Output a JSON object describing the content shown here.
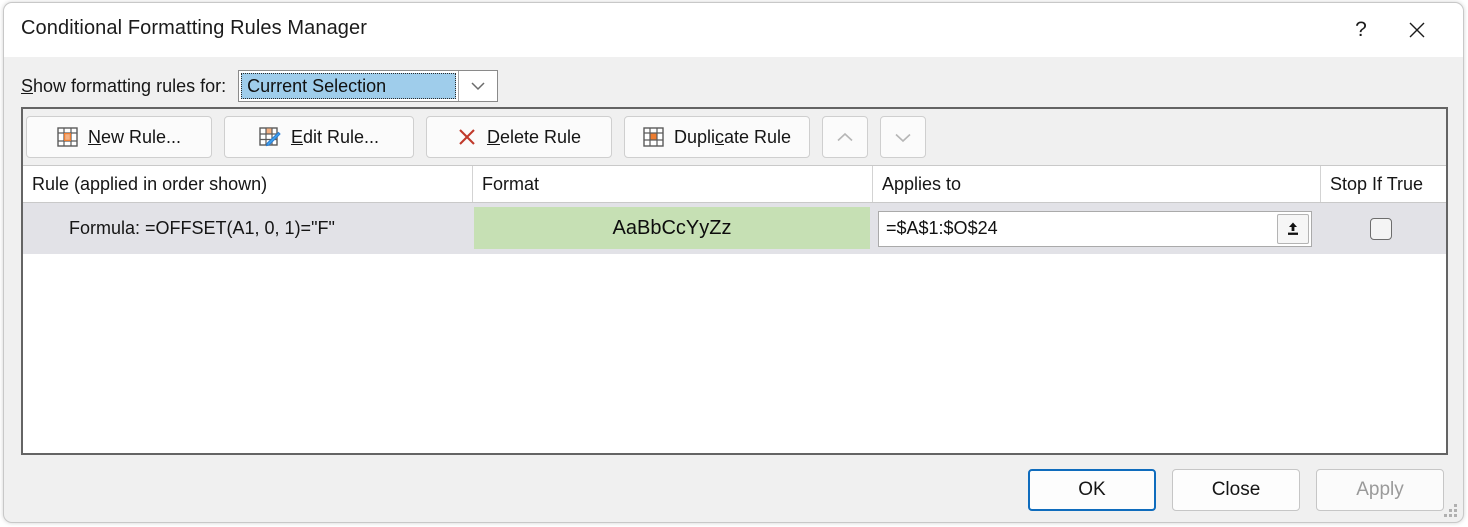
{
  "window": {
    "title": "Conditional Formatting Rules Manager",
    "help_icon": "question-mark-icon",
    "close_icon": "close-icon"
  },
  "show_rules_for": {
    "label_prefix": "S",
    "label_rest": "how formatting rules for:",
    "selected_value": "Current Selection",
    "dropdown_icon": "chevron-down-icon"
  },
  "toolbar": {
    "new_rule": {
      "accel": "N",
      "before": "",
      "after": "ew Rule...",
      "icon": "grid-new-icon"
    },
    "edit_rule": {
      "accel": "E",
      "before": "",
      "after": "dit Rule...",
      "icon": "grid-pencil-icon"
    },
    "delete_rule": {
      "accel": "D",
      "before": "",
      "after": "elete Rule",
      "icon": "red-x-icon"
    },
    "duplicate_rule": {
      "accel": "c",
      "before": "Dupli",
      "after": "ate Rule",
      "icon": "grid-duplicate-icon"
    },
    "move_up": {
      "icon": "chevron-up-icon",
      "enabled": false
    },
    "move_down": {
      "icon": "chevron-down-icon",
      "enabled": false
    }
  },
  "columns": {
    "rule": "Rule (applied in order shown)",
    "format": "Format",
    "applies_to": "Applies to",
    "stop_if_true": "Stop If True"
  },
  "rules": [
    {
      "rule_text": "Formula: =OFFSET(A1, 0, 1)=\"F\"",
      "format_preview_text": "AaBbCcYyZz",
      "format_fill_color": "#c6e0b4",
      "applies_to": "=$A$1:$O$24",
      "range_picker_icon": "range-select-icon",
      "stop_if_true": false,
      "selected": true
    }
  ],
  "footer": {
    "ok": "OK",
    "close": "Close",
    "apply": "Apply",
    "apply_enabled": false
  },
  "colors": {
    "dialog_bg": "#f0f0f0",
    "titlebar_bg": "#ffffff",
    "combo_highlight": "#9fcdeb",
    "row_selected": "#e2e2e7",
    "format_green": "#c6e0b4",
    "default_button_border": "#0f6cbd",
    "accent_orange": "#ed7d31",
    "delete_red": "#c0392b"
  }
}
